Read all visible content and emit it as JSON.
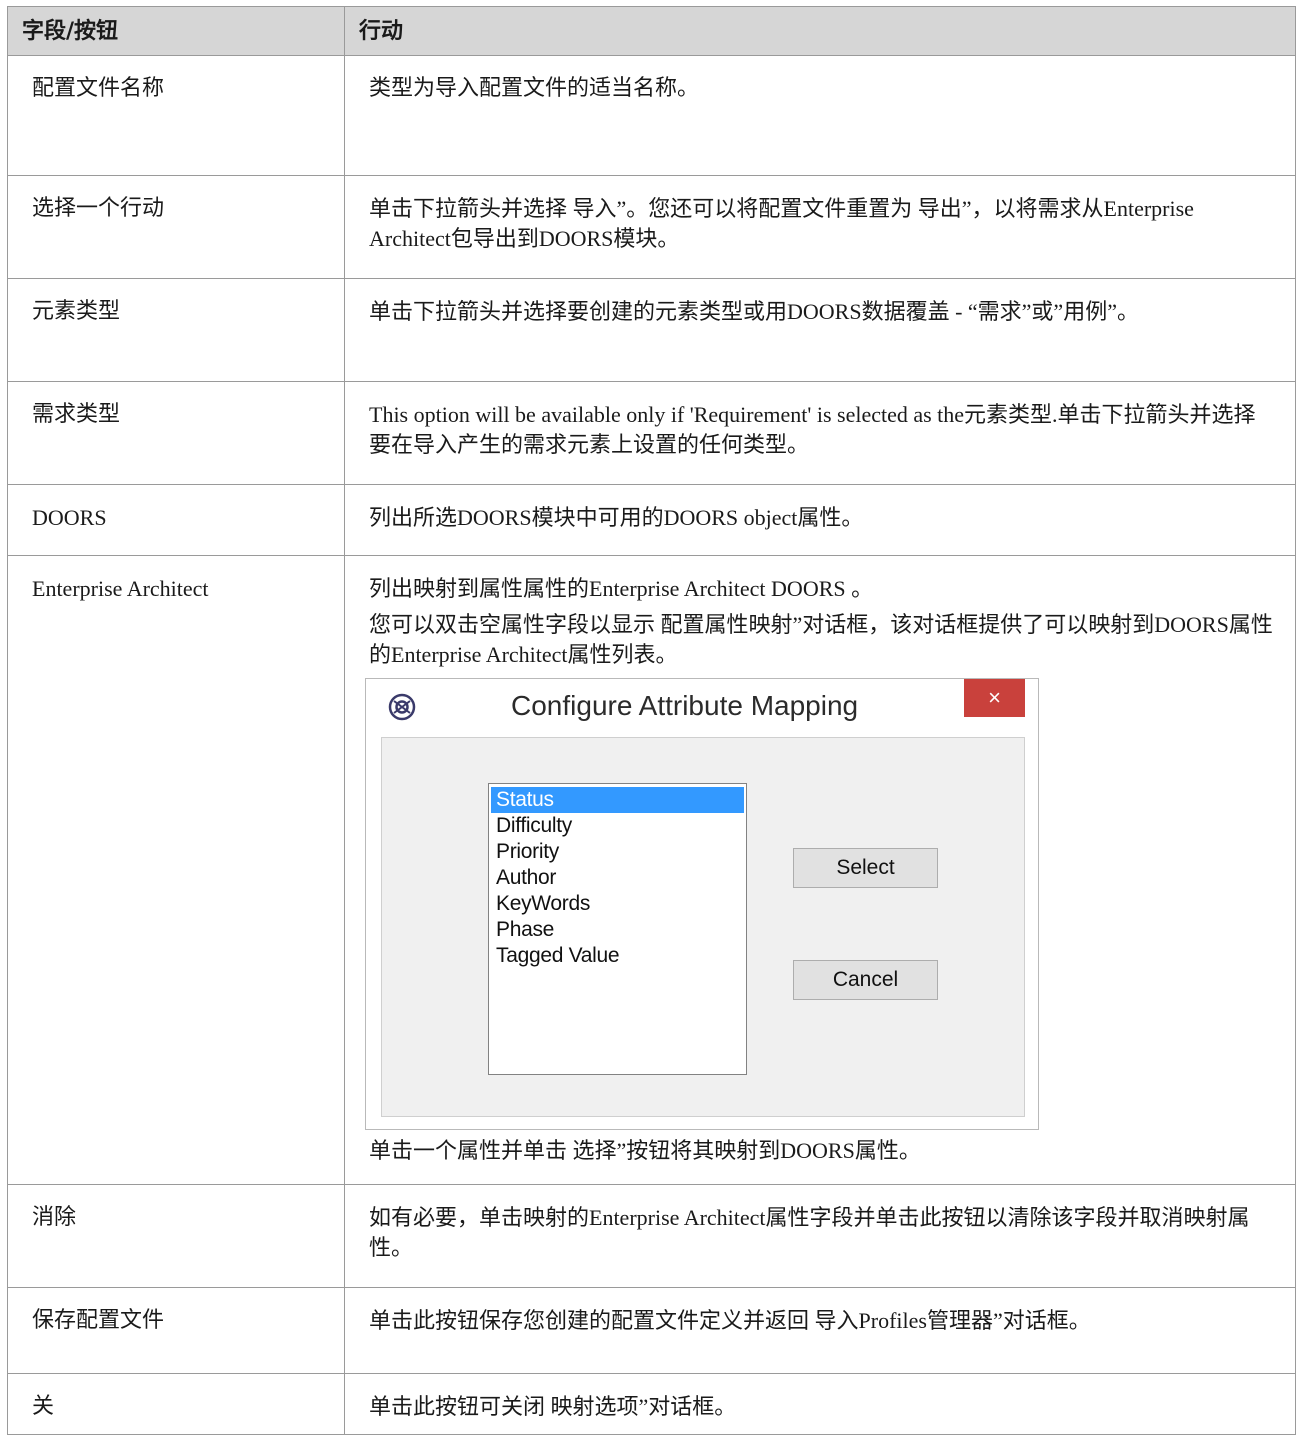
{
  "table": {
    "headers": [
      "字段/按钮",
      "行动"
    ],
    "rows": [
      {
        "field": "配置文件名称",
        "action": [
          "类型为导入配置文件的适当名称。"
        ]
      },
      {
        "field": "选择一个行动",
        "action": [
          "单击下拉箭头并选择 导入”。您还可以将配置文件重置为 导出”，以将需求从Enterprise Architect包导出到DOORS模块。"
        ]
      },
      {
        "field": "元素类型",
        "action": [
          "单击下拉箭头并选择要创建的元素类型或用DOORS数据覆盖 - “需求”或”用例”。"
        ]
      },
      {
        "field": "需求类型",
        "action": [
          "This option will be available only if 'Requirement' is selected as the元素类型.单击下拉箭头并选择要在导入产生的需求元素上设置的任何类型。"
        ]
      },
      {
        "field": "DOORS",
        "action": [
          "列出所选DOORS模块中可用的DOORS object属性。"
        ]
      },
      {
        "field": "Enterprise Architect",
        "action": [
          "列出映射到属性属性的Enterprise Architect DOORS 。",
          "您可以双击空属性字段以显示 配置属性映射”对话框，该对话框提供了可以映射到DOORS属性的Enterprise Architect属性列表。"
        ],
        "after_dialog": "单击一个属性并单击 选择”按钮将其映射到DOORS属性。"
      },
      {
        "field": "消除",
        "action": [
          "如有必要，单击映射的Enterprise Architect属性字段并单击此按钮以清除该字段并取消映射属性。"
        ]
      },
      {
        "field": "保存配置文件",
        "action": [
          "单击此按钮保存您创建的配置文件定义并返回 导入Profiles管理器”对话框。"
        ]
      },
      {
        "field": "关",
        "action": [
          "单击此按钮可关闭 映射选项”对话框。"
        ]
      }
    ]
  },
  "dialog": {
    "title": "Configure Attribute Mapping",
    "close_glyph": "×",
    "icon": "ea-logo-icon",
    "list_items": [
      "Status",
      "Difficulty",
      "Priority",
      "Author",
      "KeyWords",
      "Phase",
      "Tagged Value"
    ],
    "selected_item": "Status",
    "select_label": "Select",
    "cancel_label": "Cancel",
    "accent_color": "#3399ff",
    "close_color": "#c9413c"
  }
}
